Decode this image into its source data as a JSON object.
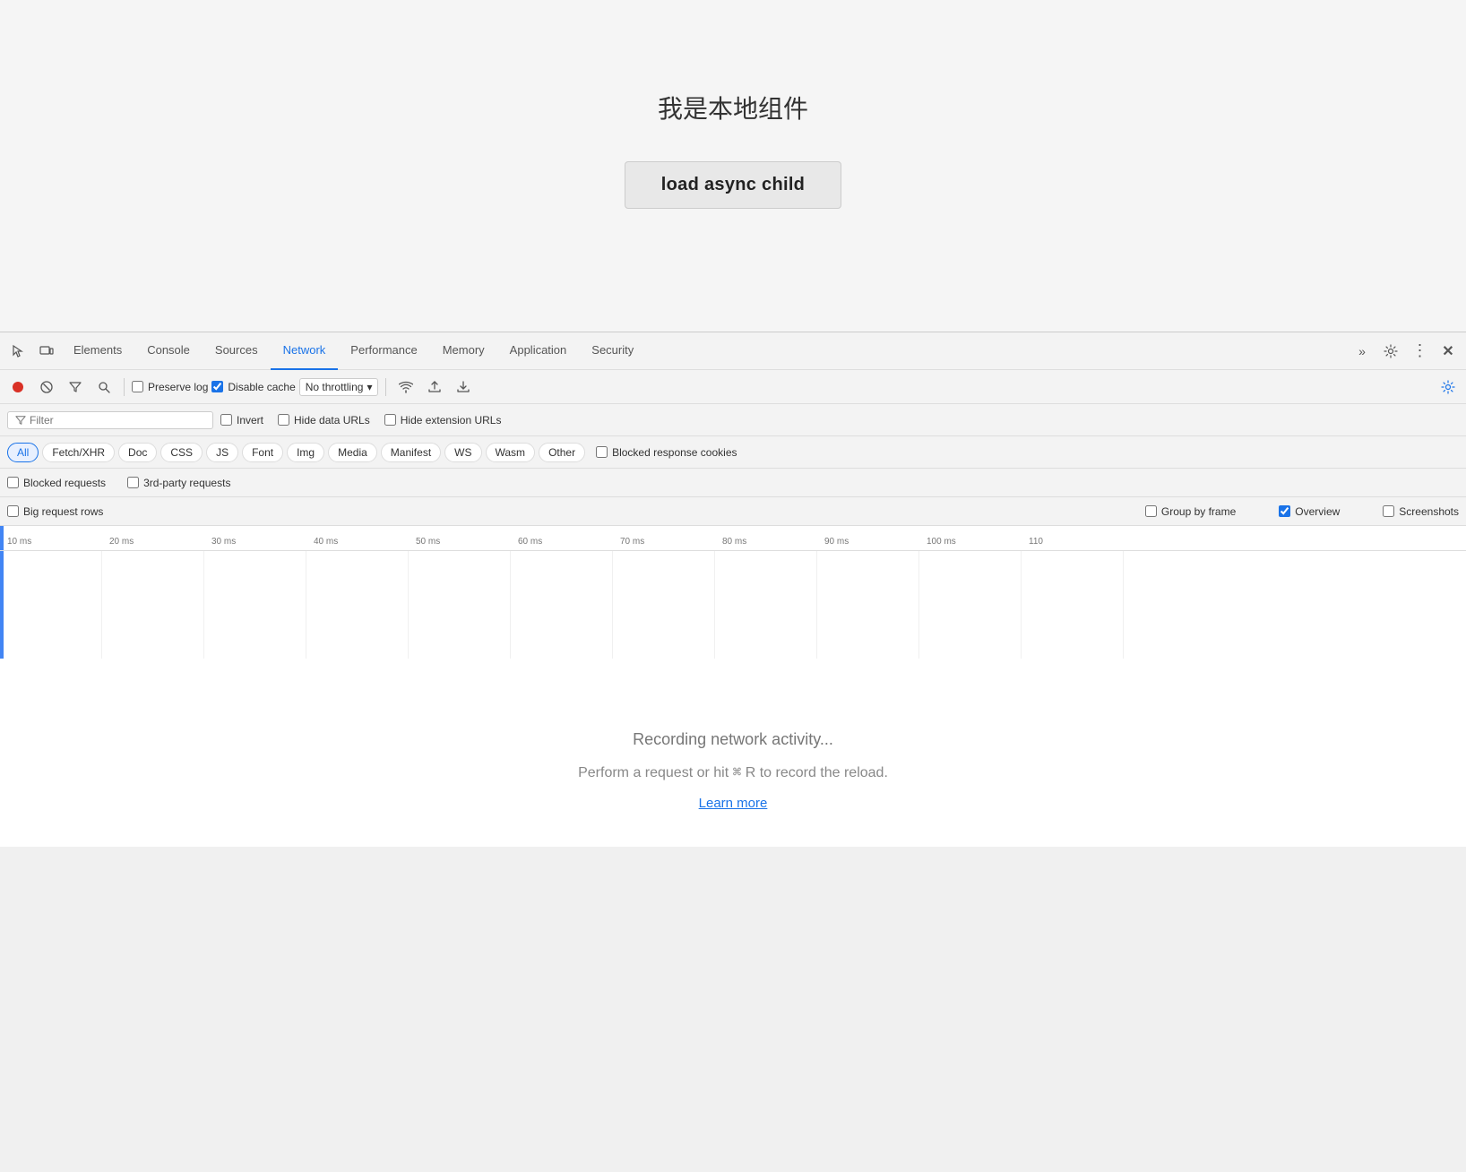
{
  "page": {
    "title": "我是本地组件",
    "button_label": "load async child"
  },
  "devtools": {
    "tabs": [
      {
        "label": "Elements",
        "active": false
      },
      {
        "label": "Console",
        "active": false
      },
      {
        "label": "Sources",
        "active": false
      },
      {
        "label": "Network",
        "active": true
      },
      {
        "label": "Performance",
        "active": false
      },
      {
        "label": "Memory",
        "active": false
      },
      {
        "label": "Application",
        "active": false
      },
      {
        "label": "Security",
        "active": false
      }
    ],
    "actionbar": {
      "preserve_log_label": "Preserve log",
      "disable_cache_label": "Disable cache",
      "throttle_label": "No throttling"
    },
    "filter": {
      "placeholder": "Filter",
      "invert_label": "Invert",
      "hide_data_urls_label": "Hide data URLs",
      "hide_extension_urls_label": "Hide extension URLs"
    },
    "resource_types": [
      {
        "label": "All",
        "active": true
      },
      {
        "label": "Fetch/XHR",
        "active": false
      },
      {
        "label": "Doc",
        "active": false
      },
      {
        "label": "CSS",
        "active": false
      },
      {
        "label": "JS",
        "active": false
      },
      {
        "label": "Font",
        "active": false
      },
      {
        "label": "Img",
        "active": false
      },
      {
        "label": "Media",
        "active": false
      },
      {
        "label": "Manifest",
        "active": false
      },
      {
        "label": "WS",
        "active": false
      },
      {
        "label": "Wasm",
        "active": false
      },
      {
        "label": "Other",
        "active": false
      }
    ],
    "blocked_cookies_label": "Blocked response cookies",
    "options_row1": {
      "blocked_requests_label": "Blocked requests",
      "third_party_label": "3rd-party requests"
    },
    "options_row2": {
      "big_rows_label": "Big request rows",
      "group_by_frame_label": "Group by frame",
      "overview_label": "Overview",
      "screenshots_label": "Screenshots"
    },
    "ruler": {
      "ticks": [
        "10 ms",
        "20 ms",
        "30 ms",
        "40 ms",
        "50 ms",
        "60 ms",
        "70 ms",
        "80 ms",
        "90 ms",
        "100 ms",
        "110"
      ]
    },
    "empty_state": {
      "title": "Recording network activity...",
      "subtitle": "Perform a request or hit ⌘ R to record the reload.",
      "link": "Learn more"
    }
  }
}
